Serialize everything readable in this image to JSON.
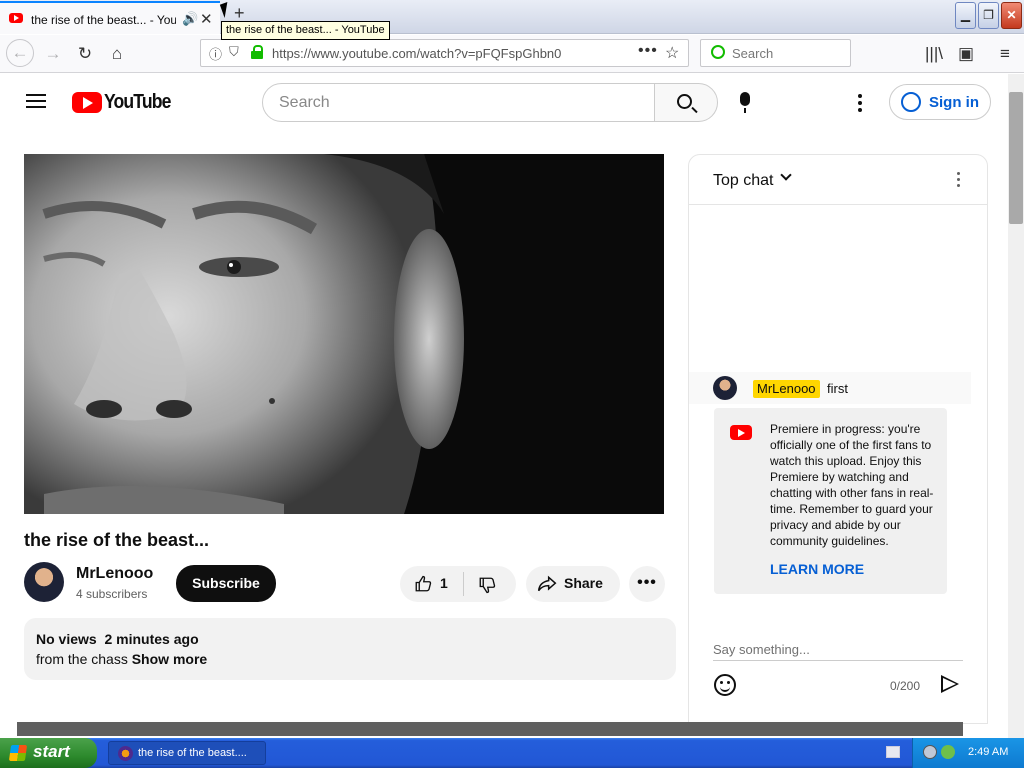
{
  "browser": {
    "tab": {
      "title": "the rise of the beast... - YouTube",
      "favicon": "youtube-favicon",
      "audio_icon": "speaker-icon"
    },
    "tooltip": "the rise of the beast... - YouTube",
    "url": "https://www.youtube.com/watch?v=pFQFspGhbn0",
    "search_placeholder": "Search",
    "window_buttons": {
      "minimize": "minimize-icon",
      "maximize": "restore-icon",
      "close": "close-icon"
    }
  },
  "youtube": {
    "logo_text": "YouTube",
    "search_placeholder": "Search",
    "sign_in": "Sign in",
    "colors": {
      "brand_red": "#ff0000",
      "link_blue": "#065fd4",
      "author_badge": "#ffd600"
    }
  },
  "video": {
    "title": "the rise of the beast...",
    "channel": {
      "name": "MrLenooo",
      "subscribers": "4 subscribers"
    },
    "subscribe_label": "Subscribe",
    "likes": "1",
    "share_label": "Share",
    "more_label": "•••",
    "description": {
      "views": "No views",
      "posted": "2 minutes ago",
      "text": "from the chass",
      "show_more": "Show more"
    }
  },
  "chat": {
    "header": "Top chat",
    "messages": [
      {
        "author": "MrLenooo",
        "text": "first"
      }
    ],
    "premiere_notice": "Premiere in progress: you're officially one of the first fans to watch this upload. Enjoy this Premiere by watching and chatting with other fans in real-time. Remember to guard your privacy and abide by our community guidelines.",
    "learn_more": "LEARN MORE",
    "input_placeholder": "Say something...",
    "char_count": "0/200"
  },
  "taskbar": {
    "start_label": "start",
    "task_label": "the rise of the beast....",
    "clock": "2:49 AM"
  }
}
